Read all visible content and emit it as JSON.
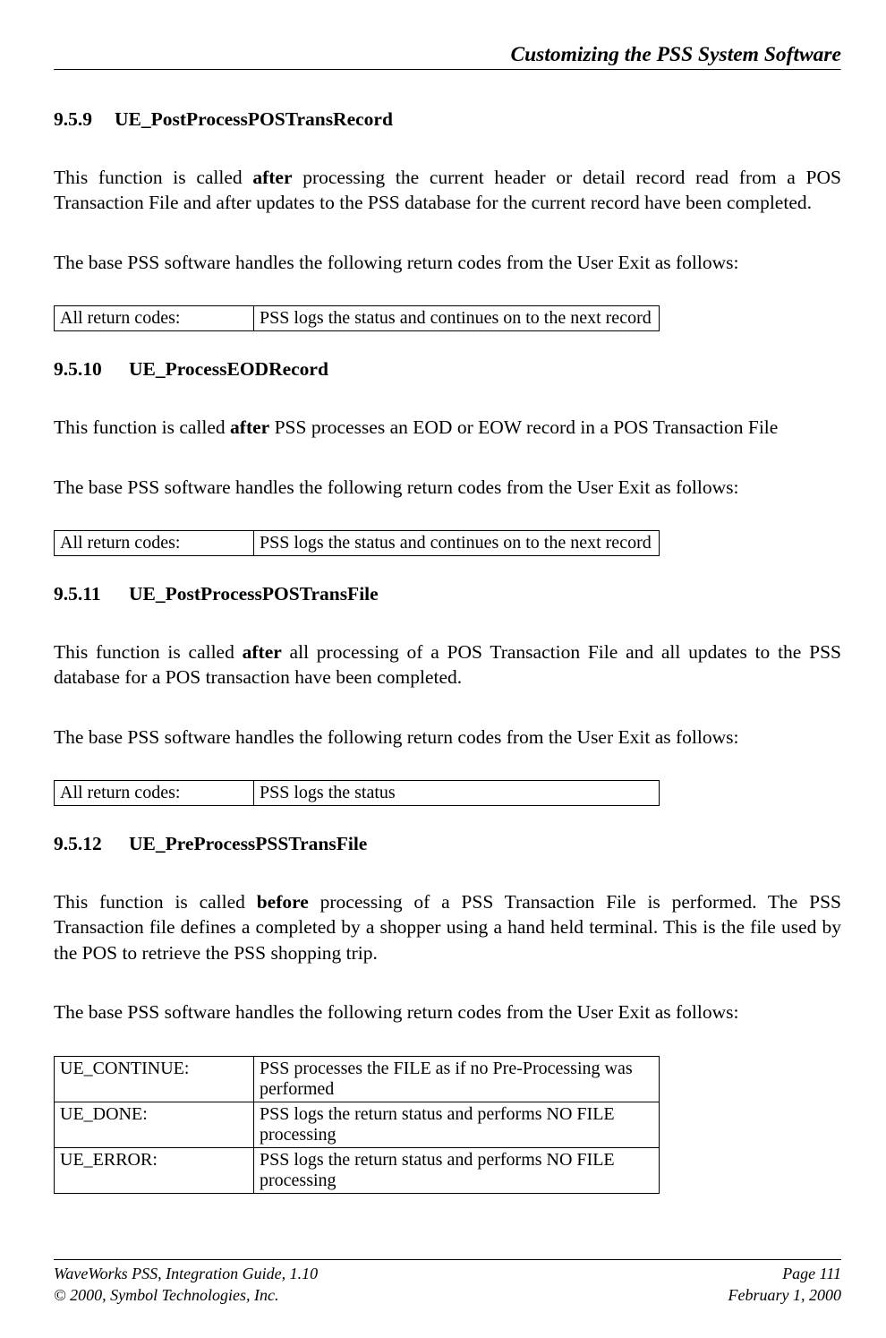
{
  "header": {
    "title": "Customizing the PSS System Software"
  },
  "sections": [
    {
      "number": "9.5.9",
      "title": "UE_PostProcessPOSTransRecord",
      "para1_pre": "This function is called ",
      "para1_bold": "after",
      "para1_post": " processing the current header or detail record read from a POS Transaction File and after updates to the PSS database for the current record have been completed.",
      "para2": "The base PSS software handles the following return codes from the User Exit as follows:",
      "table": [
        {
          "code": "All return codes:",
          "desc": "PSS logs the status and continues on to the next record"
        }
      ]
    },
    {
      "number": "9.5.10",
      "title": "UE_ProcessEODRecord",
      "para1_pre": "This function is called ",
      "para1_bold": "after",
      "para1_post": " PSS processes an EOD or EOW record in a POS Transaction File",
      "para2": "The base PSS software handles the following return codes from the User Exit as follows:",
      "table": [
        {
          "code": "All return codes:",
          "desc": "PSS logs the status and continues on to the next record"
        }
      ]
    },
    {
      "number": "9.5.11",
      "title": "UE_PostProcessPOSTransFile",
      "para1_pre": "This function is called ",
      "para1_bold": "after",
      "para1_post": " all processing of a POS Transaction File and all updates to the PSS database for a POS transaction have been completed.",
      "para2": "The base PSS software handles the following return codes from the User Exit as follows:",
      "table": [
        {
          "code": "All return codes:",
          "desc": "PSS logs the status"
        }
      ]
    },
    {
      "number": "9.5.12",
      "title": "UE_PreProcessPSSTransFile",
      "para1_pre": "This function is called ",
      "para1_bold": "before",
      "para1_post": " processing of a PSS Transaction File is performed.  The PSS Transaction file defines a completed by a shopper using a hand held terminal.  This is the file used by the POS to retrieve the PSS shopping trip.",
      "para2": "The base PSS software handles the following return codes from the User Exit as follows:",
      "table": [
        {
          "code": "UE_CONTINUE:",
          "desc": "PSS processes the FILE as if no Pre-Processing was performed"
        },
        {
          "code": "UE_DONE:",
          "desc": "PSS logs the return status and performs NO FILE processing"
        },
        {
          "code": "UE_ERROR:",
          "desc": "PSS logs the return status and performs NO FILE processing"
        }
      ]
    }
  ],
  "footer": {
    "left1": "WaveWorks PSS, Integration Guide, 1.10",
    "left2": "© 2000, Symbol Technologies, Inc.",
    "right1": "Page 111",
    "right2": "February 1, 2000"
  }
}
